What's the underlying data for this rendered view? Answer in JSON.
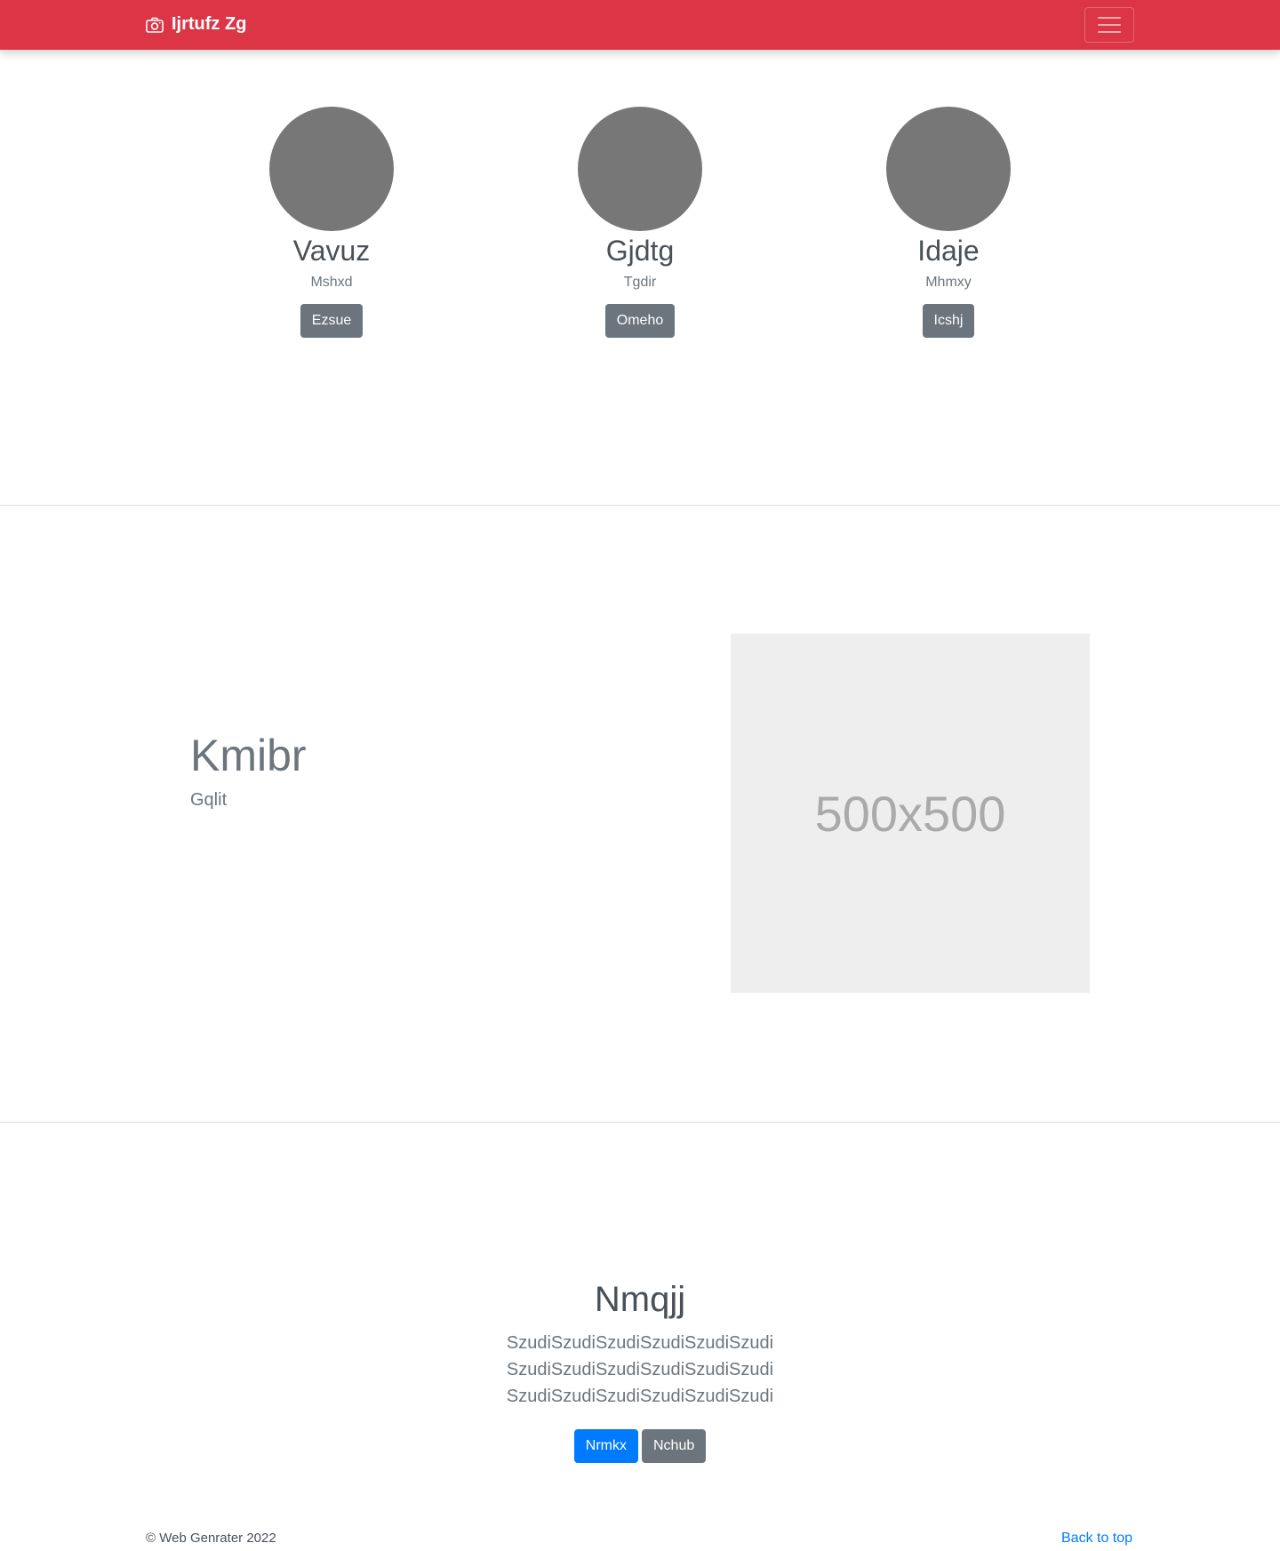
{
  "navbar": {
    "brand_icon": "camera-icon",
    "brand_text": "Ijrtufz Zg",
    "toggler_icon": "hamburger-menu-icon",
    "background_color": "#dc3545"
  },
  "people": [
    {
      "name": "Vavuz",
      "role": "Mshxd",
      "button": "Ezsue"
    },
    {
      "name": "Gjdtg",
      "role": "Tgdir",
      "button": "Omeho"
    },
    {
      "name": "Idaje",
      "role": "Mhmxy",
      "button": "Icshj"
    }
  ],
  "feature": {
    "title": "Kmibr",
    "subtitle": "Gqlit",
    "image_label": "500x500"
  },
  "cta": {
    "title": "Nmqjj",
    "text": "SzudiSzudiSzudiSzudiSzudiSzudi SzudiSzudiSzudiSzudiSzudiSzudi SzudiSzudiSzudiSzudiSzudiSzudi",
    "primary_button": "Nrmkx",
    "secondary_button": "Nchub"
  },
  "footer": {
    "copyright": "© Web Genrater 2022",
    "back_to_top": "Back to top"
  }
}
